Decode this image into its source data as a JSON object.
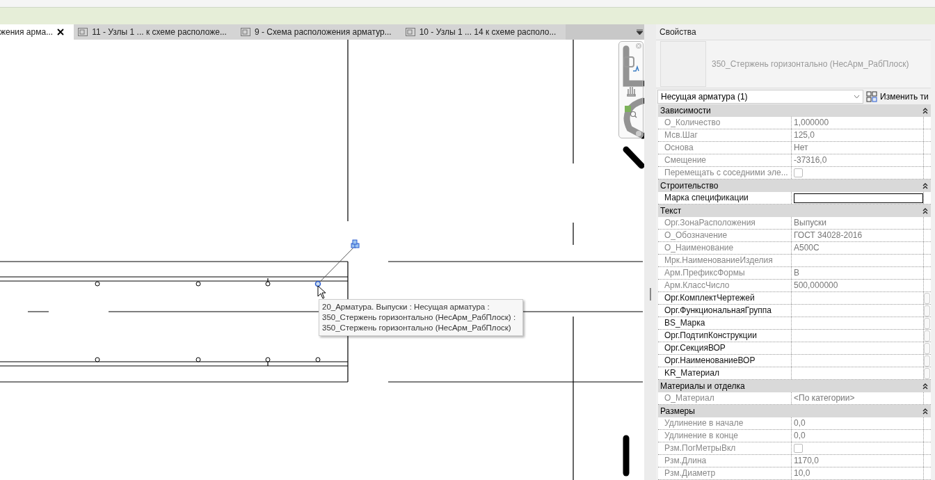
{
  "tabs": [
    {
      "label": "жения арма...",
      "selected": true,
      "closable": true
    },
    {
      "label": "11 - Узлы 1 ... к схеме расположе...",
      "selected": false,
      "closable": false
    },
    {
      "label": "9 - Схема расположения арматур...",
      "selected": false,
      "closable": false
    },
    {
      "label": "10 - Узлы 1 ... 14 к схеме располо...",
      "selected": false,
      "closable": false
    }
  ],
  "tooltip": [
    "20_Арматура. Выпуски : Несущая арматура :",
    "350_Стержень горизонтально (НесАрм_РабПлоск) :",
    "350_Стержень горизонтально (НесАрм_РабПлоск)"
  ],
  "properties": {
    "title": "Свойства",
    "type_name": "350_Стержень горизонтально (НесАрм_РабПлоск)",
    "selector": "Несущая арматура (1)",
    "edit_type": "Изменить ти",
    "groups": [
      {
        "title": "Зависимости",
        "expanded": true,
        "rows": [
          {
            "kind": "text",
            "label": "О_Количество",
            "value": "1,000000",
            "editable": false
          },
          {
            "kind": "text",
            "label": "Мсв.Шаг",
            "value": "125,0",
            "editable": false
          },
          {
            "kind": "text",
            "label": "Основа",
            "value": "Нет",
            "editable": false
          },
          {
            "kind": "text",
            "label": "Смещение",
            "value": "-37316,0",
            "editable": false
          },
          {
            "kind": "checkbox",
            "label": "Перемещать с соседними эле...",
            "checked": false,
            "editable": false
          }
        ]
      },
      {
        "title": "Строительство",
        "expanded": true,
        "rows": [
          {
            "kind": "input",
            "label": "Марка спецификации",
            "editable": true
          }
        ]
      },
      {
        "title": "Текст",
        "expanded": true,
        "rows": [
          {
            "kind": "text",
            "label": "Орг.ЗонаРасположения",
            "value": "Выпуски",
            "editable": false
          },
          {
            "kind": "text",
            "label": "О_Обозначение",
            "value": "ГОСТ 34028-2016",
            "editable": false
          },
          {
            "kind": "text",
            "label": "О_Наименование",
            "value": "А500С",
            "editable": false
          },
          {
            "kind": "text",
            "label": "Мрк.НаименованиеИзделия",
            "editable": false
          },
          {
            "kind": "text",
            "label": "Арм.ПрефиксФормы",
            "value": "В",
            "editable": false
          },
          {
            "kind": "text",
            "label": "Арм.КлассЧисло",
            "value": "500,000000",
            "editable": false
          },
          {
            "kind": "text",
            "label": "Орг.КомплектЧертежей",
            "editable": true
          },
          {
            "kind": "text",
            "label": "Орг.ФункциональнаяГруппа",
            "editable": true
          },
          {
            "kind": "text",
            "label": "BS_Марка",
            "editable": true
          },
          {
            "kind": "text",
            "label": "Орг.ПодтипКонструкции",
            "editable": true
          },
          {
            "kind": "text",
            "label": "Орг.СекцияВОР",
            "editable": true
          },
          {
            "kind": "text",
            "label": "Орг.НаименованиеВОР",
            "editable": true
          },
          {
            "kind": "text",
            "label": "KR_Материал",
            "editable": true
          }
        ]
      },
      {
        "title": "Материалы и отделка",
        "expanded": true,
        "rows": [
          {
            "kind": "text",
            "label": "О_Материал",
            "value": "<По категории>",
            "editable": false
          }
        ]
      },
      {
        "title": "Размеры",
        "expanded": true,
        "rows": [
          {
            "kind": "text",
            "label": "Удлинение в начале",
            "value": "0,0",
            "editable": false
          },
          {
            "kind": "text",
            "label": "Удлинение в конце",
            "value": "0,0",
            "editable": false
          },
          {
            "kind": "checkbox",
            "label": "Рзм.ПогМетрыВкл",
            "checked": false,
            "editable": false
          },
          {
            "kind": "text",
            "label": "Рзм.Длина",
            "value": "1170,0",
            "editable": false
          },
          {
            "kind": "text",
            "label": "Рзм.Диаметр",
            "value": "10,0",
            "editable": false
          }
        ]
      }
    ]
  }
}
